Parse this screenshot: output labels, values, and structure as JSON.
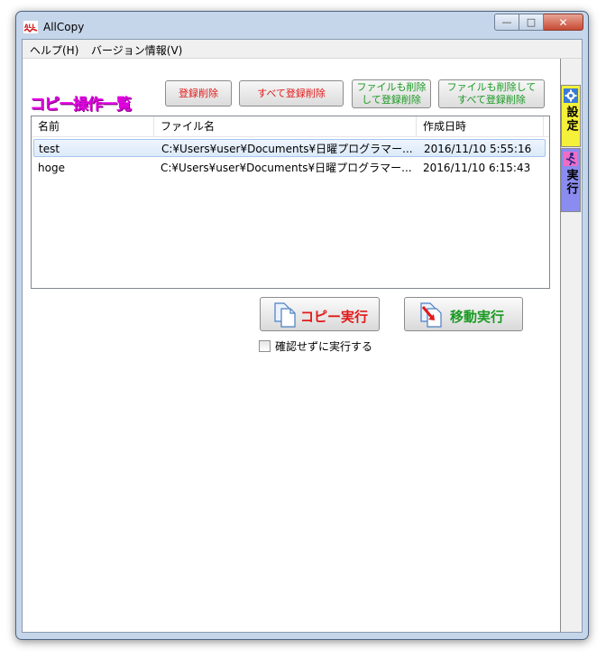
{
  "window": {
    "title": "AllCopy",
    "app_icon_text": "ALL"
  },
  "window_buttons": {
    "minimize": "—",
    "maximize": "□",
    "close": "✕"
  },
  "menu": [
    "ヘルプ(H)",
    "バージョン情報(V)"
  ],
  "section_title": "コピー操作一覧",
  "toolbar": {
    "delete_entry": "登録削除",
    "delete_all": "すべて登録削除",
    "delete_files_1": "ファイルも削除",
    "delete_files_2": "して登録削除",
    "delete_all_files_1": "ファイルも削除して",
    "delete_all_files_2": "すべて登録削除"
  },
  "list": {
    "columns": [
      "名前",
      "ファイル名",
      "作成日時"
    ],
    "rows": [
      {
        "name": "test",
        "file": "C:¥Users¥user¥Documents¥日曜プログラマー...",
        "created": "2016/11/10 5:55:16",
        "selected": true
      },
      {
        "name": "hoge",
        "file": "C:¥Users¥user¥Documents¥日曜プログラマー...",
        "created": "2016/11/10 6:15:43",
        "selected": false
      }
    ]
  },
  "actions": {
    "copy": "コピー実行",
    "move": "移動実行"
  },
  "confirm_checkbox": {
    "label": "確認せずに実行する",
    "checked": false
  },
  "side_tabs": [
    {
      "label": "設定",
      "icon": "gear-icon",
      "color": "#f5f03a"
    },
    {
      "label": "実行",
      "icon": "runner-icon",
      "color": "#8a8cf0"
    }
  ],
  "colors": {
    "title_magenta": "#e400e4",
    "red_label": "#e21919",
    "green_label": "#1a9a22",
    "selection": "#dceaf9"
  }
}
